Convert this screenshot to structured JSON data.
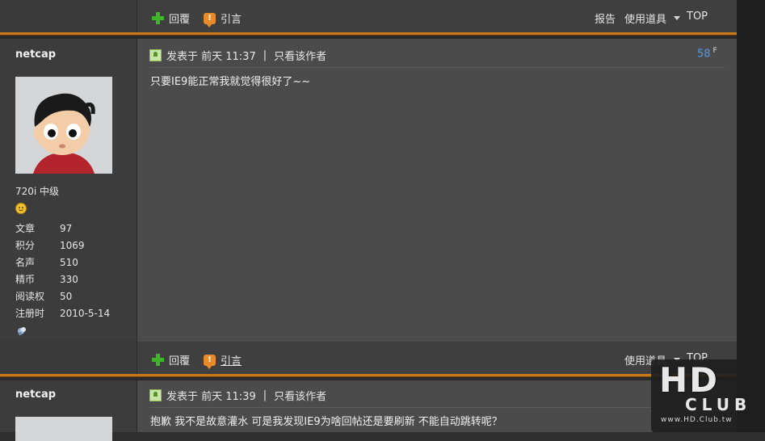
{
  "top_bar": {
    "reply": "回覆",
    "quote": "引言",
    "report": "报告",
    "tools": "使用道具",
    "top": "TOP"
  },
  "posts": [
    {
      "username": "netcap",
      "level": "720i 中级",
      "stats": [
        {
          "label": "文章",
          "value": "97"
        },
        {
          "label": "积分",
          "value": "1069"
        },
        {
          "label": "名声",
          "value": "510"
        },
        {
          "label": "精币",
          "value": "330"
        },
        {
          "label": "阅读权",
          "value": "50"
        },
        {
          "label": "注册时",
          "value": "2010-5-14"
        }
      ],
      "posted_label": "发表于 前天 11:37",
      "divider": "|",
      "author_only": "只看该作者",
      "floor": "58",
      "floor_suffix": "F",
      "content": "只要IE9能正常我就觉得很好了~~",
      "actions": {
        "reply": "回覆",
        "quote": "引言",
        "tools": "使用道具",
        "top": "TOP"
      }
    },
    {
      "username": "netcap",
      "posted_label": "发表于 前天 11:39",
      "divider": "|",
      "author_only": "只看该作者",
      "content": "抱歉 我不是故意灌水 可是我发现IE9为啥回帖还是要刷新 不能自动跳转呢？"
    }
  ],
  "watermark": {
    "logo": "HD",
    "club": "CLUB",
    "url": "www.HD.Club.tw"
  }
}
